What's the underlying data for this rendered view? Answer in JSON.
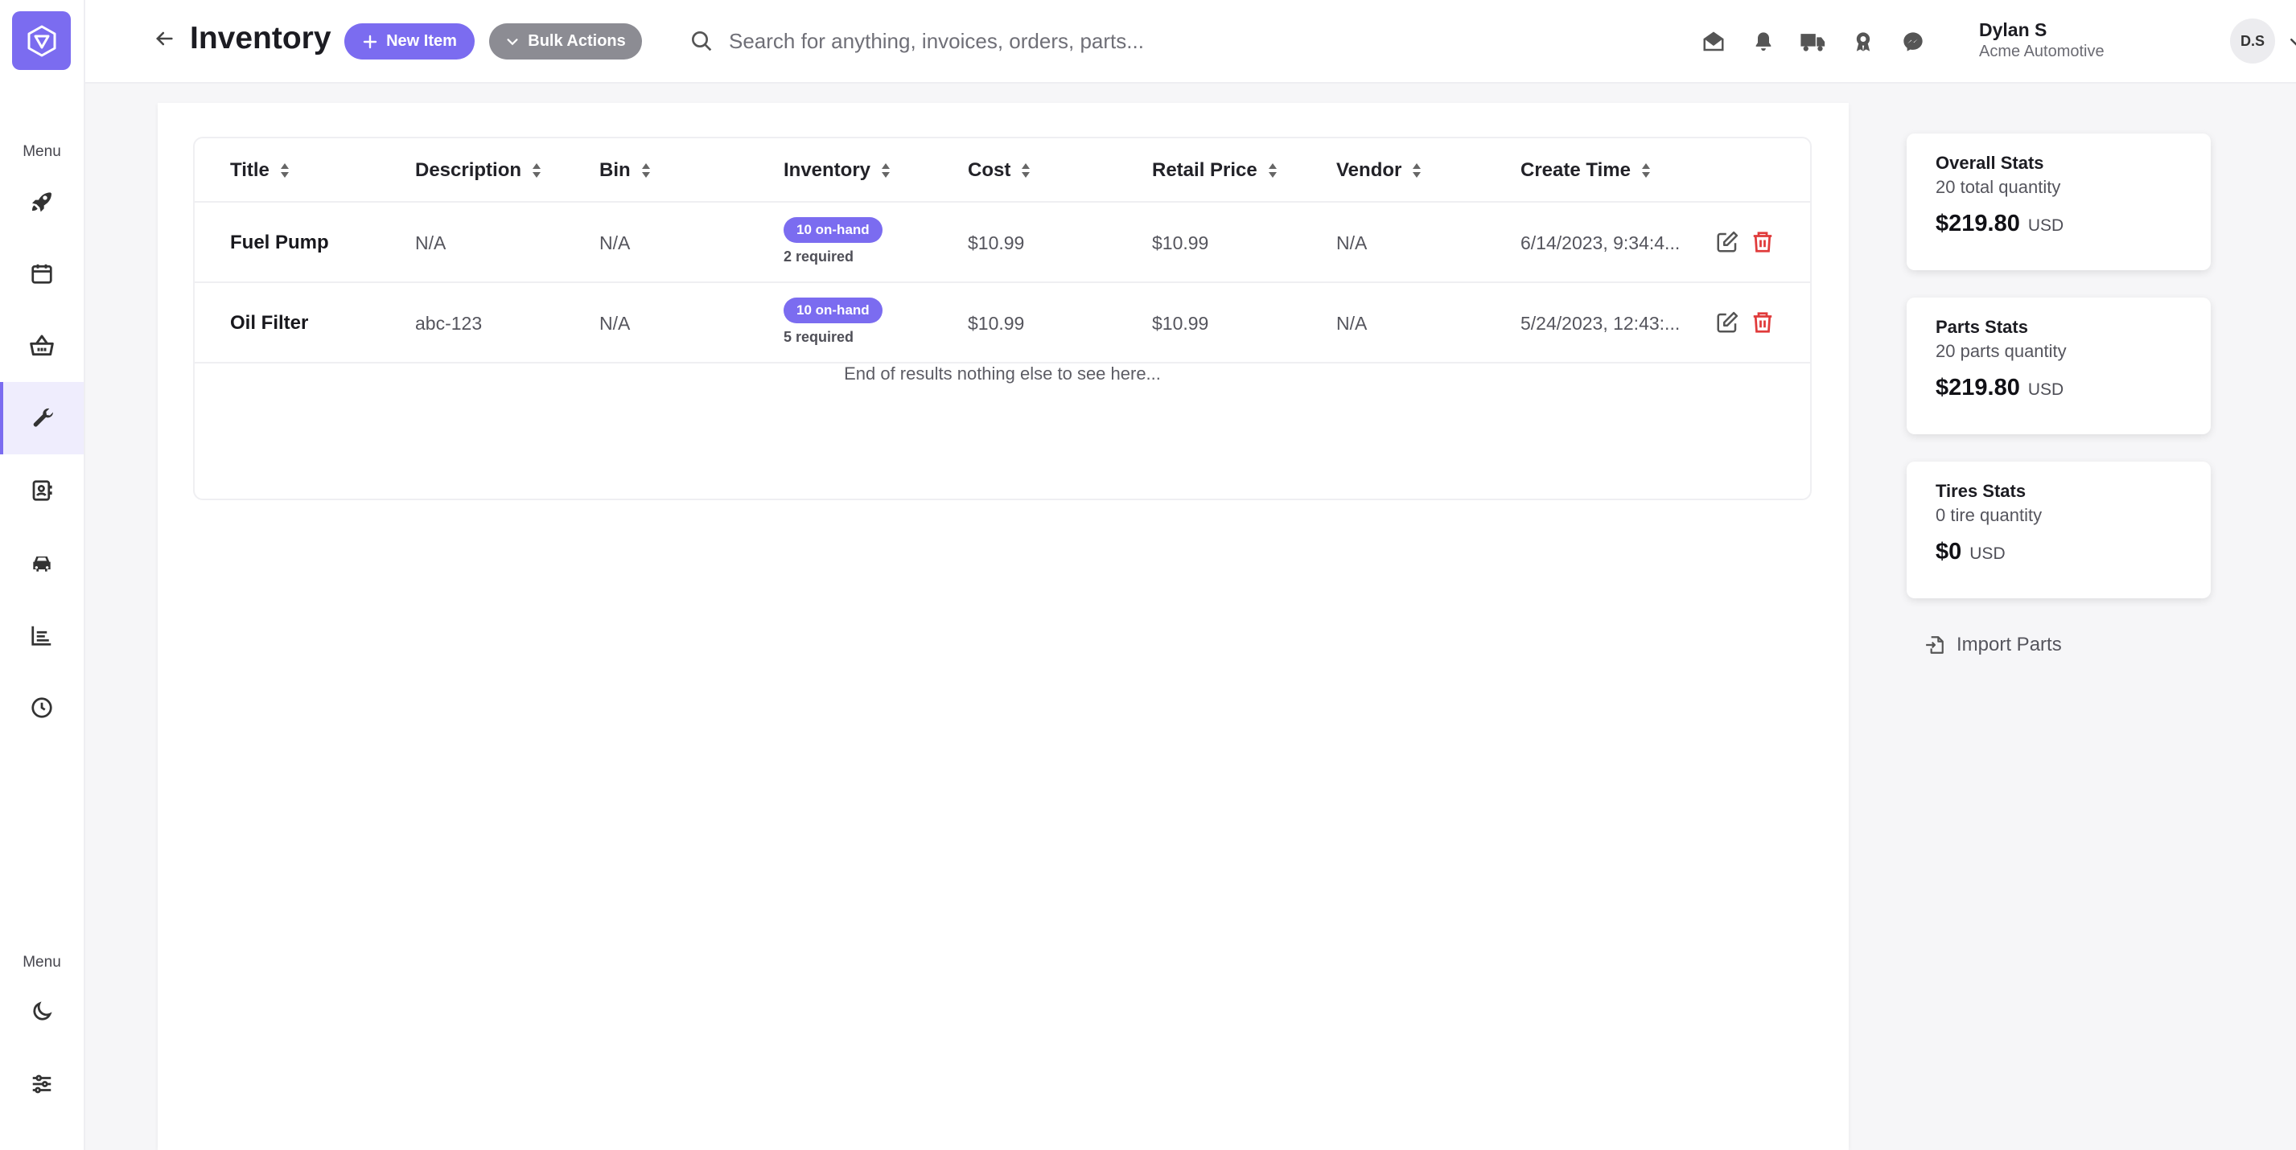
{
  "sidebar": {
    "top_label": "Menu",
    "bottom_label": "Menu",
    "items": [
      {
        "name": "rocket-icon"
      },
      {
        "name": "calendar-icon"
      },
      {
        "name": "basket-icon"
      },
      {
        "name": "wrench-icon",
        "active": true
      },
      {
        "name": "contacts-icon"
      },
      {
        "name": "car-icon"
      },
      {
        "name": "chart-icon"
      },
      {
        "name": "clock-icon"
      }
    ],
    "bottom_items": [
      {
        "name": "moon-icon"
      },
      {
        "name": "sliders-icon"
      }
    ]
  },
  "header": {
    "title": "Inventory",
    "new_item_label": "New Item",
    "bulk_actions_label": "Bulk Actions",
    "search_placeholder": "Search for anything, invoices, orders, parts...",
    "user_name": "Dylan S",
    "user_company": "Acme Automotive",
    "avatar_initials": "D.S"
  },
  "table": {
    "columns": [
      "Title",
      "Description",
      "Bin",
      "Inventory",
      "Cost",
      "Retail Price",
      "Vendor",
      "Create Time"
    ],
    "rows": [
      {
        "title": "Fuel Pump",
        "description": "N/A",
        "bin": "N/A",
        "on_hand": "10 on-hand",
        "required": "2 required",
        "cost": "$10.99",
        "retail": "$10.99",
        "vendor": "N/A",
        "created": "6/14/2023, 9:34:4..."
      },
      {
        "title": "Oil Filter",
        "description": "abc-123",
        "bin": "N/A",
        "on_hand": "10 on-hand",
        "required": "5 required",
        "cost": "$10.99",
        "retail": "$10.99",
        "vendor": "N/A",
        "created": "5/24/2023, 12:43:..."
      }
    ],
    "end_message": "End of results nothing else to see here..."
  },
  "stats": [
    {
      "title": "Overall Stats",
      "subtitle": "20 total quantity",
      "amount": "$219.80",
      "currency": "USD"
    },
    {
      "title": "Parts Stats",
      "subtitle": "20 parts quantity",
      "amount": "$219.80",
      "currency": "USD"
    },
    {
      "title": "Tires Stats",
      "subtitle": "0 tire quantity",
      "amount": "$0",
      "currency": "USD"
    }
  ],
  "import_label": "Import Parts",
  "colors": {
    "accent": "#7b6cf0",
    "delete": "#e03b3b",
    "secondary_button": "#8c8c93"
  }
}
